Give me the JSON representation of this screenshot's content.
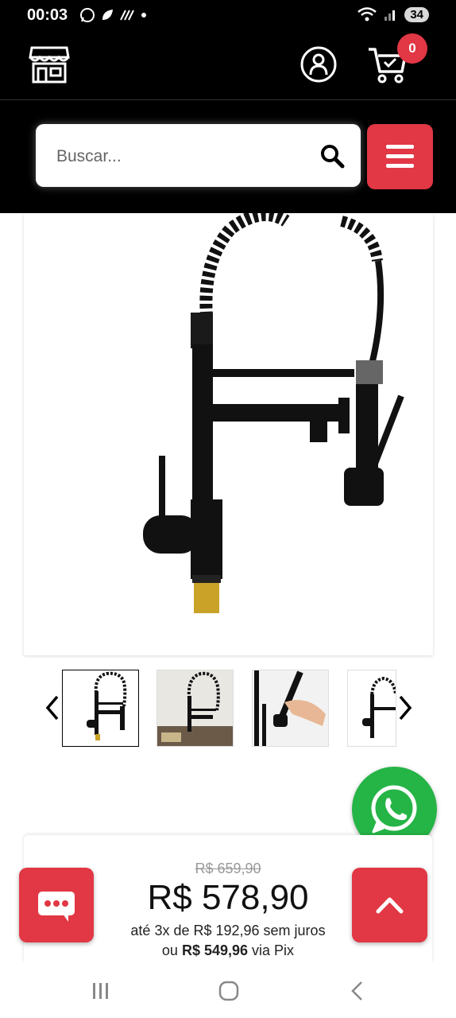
{
  "status_bar": {
    "time": "00:03",
    "battery": "34"
  },
  "header": {
    "cart_count": "0"
  },
  "search": {
    "placeholder": "Buscar..."
  },
  "product": {
    "old_price": "R$ 659,90",
    "price": "R$ 578,90",
    "installments": "até 3x de R$ 192,96 sem juros",
    "pix_prefix": "ou ",
    "pix_price": "R$ 549,96",
    "pix_suffix": " via Pix"
  },
  "thumbnails": [
    "faucet-front",
    "faucet-kitchen",
    "faucet-hand-spray",
    "faucet-side"
  ],
  "colors": {
    "accent": "#e23744",
    "whatsapp": "#25b446",
    "header_bg": "#000000"
  }
}
